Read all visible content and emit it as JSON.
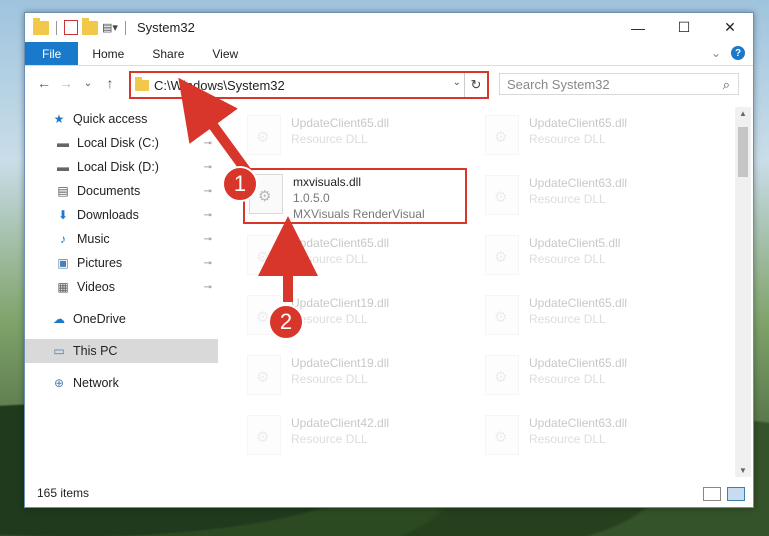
{
  "window": {
    "title": "System32",
    "min_glyph": "—",
    "max_glyph": "☐",
    "close_glyph": "✕"
  },
  "ribbon": {
    "tabs": [
      "File",
      "Home",
      "Share",
      "View"
    ],
    "expand_glyph": "⌄",
    "help_glyph": "?"
  },
  "nav": {
    "back": "←",
    "forward": "→",
    "recent": "⌄",
    "up": "↑"
  },
  "address": {
    "path": "C:\\Windows\\System32",
    "dropdown_glyph": "⌄",
    "refresh_glyph": "↻"
  },
  "search": {
    "placeholder": "Search System32",
    "icon_glyph": "⌕"
  },
  "sidebar": {
    "items": [
      {
        "label": "Quick access",
        "icon": "★",
        "pinned": false
      },
      {
        "label": "Local Disk (C:)",
        "icon": "▬",
        "pinned": true
      },
      {
        "label": "Local Disk (D:)",
        "icon": "▬",
        "pinned": true
      },
      {
        "label": "Documents",
        "icon": "▤",
        "pinned": true
      },
      {
        "label": "Downloads",
        "icon": "⬇",
        "pinned": true
      },
      {
        "label": "Music",
        "icon": "♪",
        "pinned": true
      },
      {
        "label": "Pictures",
        "icon": "▣",
        "pinned": true
      },
      {
        "label": "Videos",
        "icon": "▦",
        "pinned": true
      },
      {
        "label": "OneDrive",
        "icon": "☁",
        "pinned": false
      },
      {
        "label": "This PC",
        "icon": "▭",
        "pinned": false
      },
      {
        "label": "Network",
        "icon": "⊕",
        "pinned": false
      }
    ],
    "pin_glyph": "⊸"
  },
  "files": {
    "highlighted": {
      "name": "mxvisuals.dll",
      "version": "1.0.5.0",
      "description": "MXVisuals RenderVisual"
    },
    "faded": [
      {
        "name": "UpdateClient65.dll",
        "type": "Resource DLL"
      },
      {
        "name": "UpdateClient65.dll",
        "type": "Resource DLL"
      },
      {
        "name": "UpdateClient63.dll",
        "type": "Resource DLL"
      },
      {
        "name": "UpdateClient65.dll",
        "type": "Resource DLL"
      },
      {
        "name": "UpdateClient5.dll",
        "type": "Resource DLL"
      },
      {
        "name": "UpdateClient19.dll",
        "type": "Resource DLL"
      },
      {
        "name": "UpdateClient65.dll",
        "type": "Resource DLL"
      },
      {
        "name": "UpdateClient19.dll",
        "type": "Resource DLL"
      },
      {
        "name": "UpdateClient65.dll",
        "type": "Resource DLL"
      },
      {
        "name": "UpdateClient42.dll",
        "type": "Resource DLL"
      },
      {
        "name": "UpdateClient63.dll",
        "type": "Resource DLL"
      }
    ]
  },
  "status": {
    "count": "165 items"
  },
  "callouts": [
    "1",
    "2"
  ],
  "colors": {
    "accent": "#1979ca",
    "highlight": "#d9362b"
  }
}
